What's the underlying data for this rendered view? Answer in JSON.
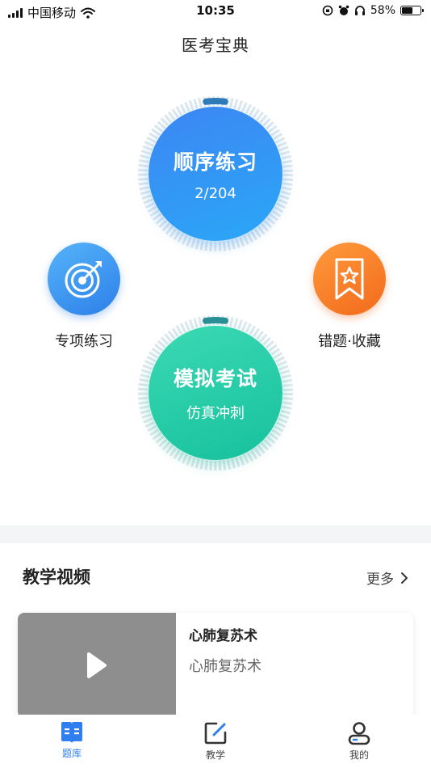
{
  "status_bar": {
    "carrier": "中国移动",
    "time": "10:35",
    "battery_percent": "58%",
    "battery_level": 0.58
  },
  "app_title": "医考宝典",
  "sequential_practice": {
    "label": "顺序练习",
    "progress_text": "2/204",
    "progress_done": 2,
    "progress_total": 204,
    "color": "#3d86f2"
  },
  "mock_exam": {
    "label": "模拟考试",
    "subtitle": "仿真冲刺",
    "color": "#1fc7a2"
  },
  "special_practice": {
    "label": "专项练习",
    "icon": "target-icon"
  },
  "wrong_favorites": {
    "label": "错题·收藏",
    "icon": "star-bookmark-icon"
  },
  "video_section": {
    "title": "教学视频",
    "more_label": "更多",
    "videos": [
      {
        "title": "心肺复苏术",
        "description": "心肺复苏术"
      }
    ]
  },
  "tab_bar": {
    "tabs": [
      {
        "label": "题库",
        "icon": "question-bank-icon",
        "active": true
      },
      {
        "label": "教学",
        "icon": "edit-icon",
        "active": false
      },
      {
        "label": "我的",
        "icon": "profile-icon",
        "active": false
      }
    ]
  },
  "colors": {
    "accent": "#2f7ff0",
    "orange": "#f26a1b",
    "ring_track": "#dde8ee"
  }
}
